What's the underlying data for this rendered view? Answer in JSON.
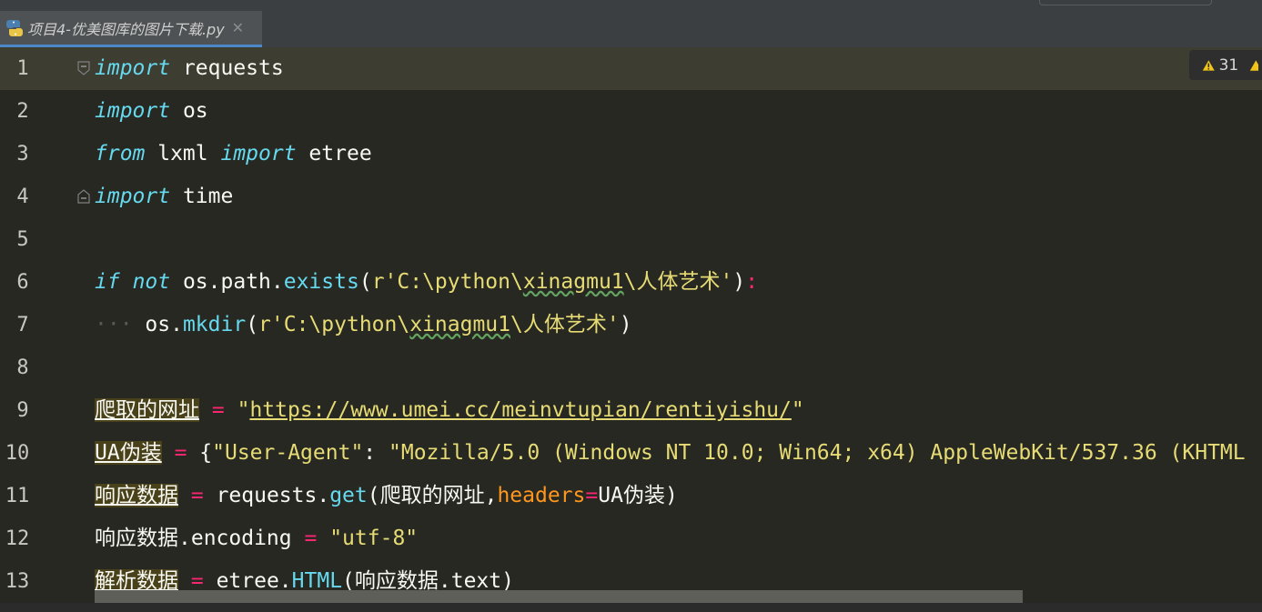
{
  "window": {
    "tab": {
      "title": "项目4-优美图库的图片下载.py",
      "close_glyph": "✕",
      "file_type_icon": "python-file-icon"
    }
  },
  "colors": {
    "background": "#272822",
    "current_line": "#3e3d32",
    "keyword": "#66d9ef",
    "string": "#e6db74",
    "operator": "#f92672",
    "parameter": "#fd971f",
    "warning": "#f0c419"
  },
  "inspection": {
    "warning_count": "31",
    "icon": "warning-triangle-icon"
  },
  "editor": {
    "current_line": 1,
    "lines": [
      {
        "num": "1",
        "t": [
          "import",
          " requests"
        ]
      },
      {
        "num": "2",
        "t": [
          "import",
          " os"
        ]
      },
      {
        "num": "3",
        "t": [
          "from",
          " lxml ",
          "import",
          " etree"
        ]
      },
      {
        "num": "4",
        "t": [
          "import",
          " time"
        ]
      },
      {
        "num": "5",
        "t": []
      },
      {
        "num": "6",
        "t": [
          "if",
          " ",
          "not",
          " os.path.",
          "exists",
          "(",
          "r'C:\\python\\",
          "xinagmu1",
          "\\人体艺术'",
          ")",
          ":"
        ]
      },
      {
        "num": "7",
        "t": [
          "···",
          " os.",
          "mkdir",
          "(",
          "r'C:\\python\\",
          "xinagmu1",
          "\\人体艺术'",
          ")"
        ]
      },
      {
        "num": "8",
        "t": []
      },
      {
        "num": "9",
        "t": [
          "爬取的网址",
          " ",
          "=",
          " ",
          "\"",
          "https://www.umei.cc/meinvtupian/rentiyishu/",
          "\""
        ]
      },
      {
        "num": "10",
        "t": [
          "UA伪装",
          " ",
          "=",
          " {",
          "\"User-Agent\"",
          ": ",
          "\"Mozilla/5.0 (Windows NT 10.0; Win64; x64) AppleWebKit/537.36 (KHTML"
        ]
      },
      {
        "num": "11",
        "t": [
          "响应数据",
          " ",
          "=",
          " requests.",
          "get",
          "(爬取的网址,",
          "headers",
          "=",
          "UA伪装)"
        ]
      },
      {
        "num": "12",
        "t": [
          "响应数据.encoding ",
          "=",
          " ",
          "\"utf-8\""
        ]
      },
      {
        "num": "13",
        "t": [
          "解析数据",
          " ",
          "=",
          " etree.",
          "HTML",
          "(响应数据.text)"
        ]
      }
    ]
  }
}
